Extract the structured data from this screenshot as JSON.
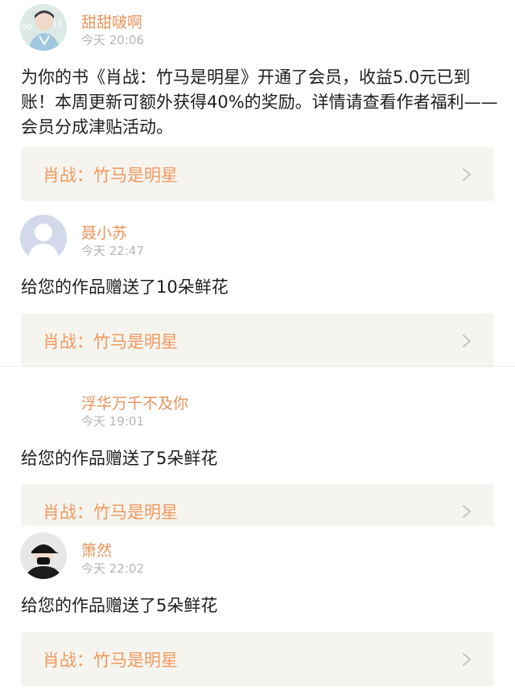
{
  "messages": [
    {
      "user": "甜甜啵啊",
      "time": "今天 20:06",
      "avatar_icon": "idol-photo-avatar",
      "text": "为你的书《肖战：竹马是明星》开通了会员，收益5.0元已到账！本周更新可额外获得40%的奖励。详情请查看作者福利——会员分成津贴活动。",
      "card_title": "肖战：竹马是明星"
    },
    {
      "user": "聂小苏",
      "time": "今天 22:47",
      "avatar_icon": "default-user-avatar",
      "text": "给您的作品赠送了10朵鲜花",
      "card_title": "肖战：竹马是明星"
    },
    {
      "user": "浮华万千不及你",
      "time": "今天 19:01",
      "avatar_icon": "blank-avatar",
      "text": "给您的作品赠送了5朵鲜花",
      "card_title": "肖战：竹马是明星"
    },
    {
      "user": "箫然",
      "time": "今天 22:02",
      "avatar_icon": "black-cap-photo-avatar",
      "text": "给您的作品赠送了5朵鲜花",
      "card_title": "肖战：竹马是明星"
    }
  ],
  "colors": {
    "username": "#e8935a",
    "card_title": "#ef9a5f",
    "card_bg": "#f6f4ef",
    "time": "#b5b5b5"
  }
}
